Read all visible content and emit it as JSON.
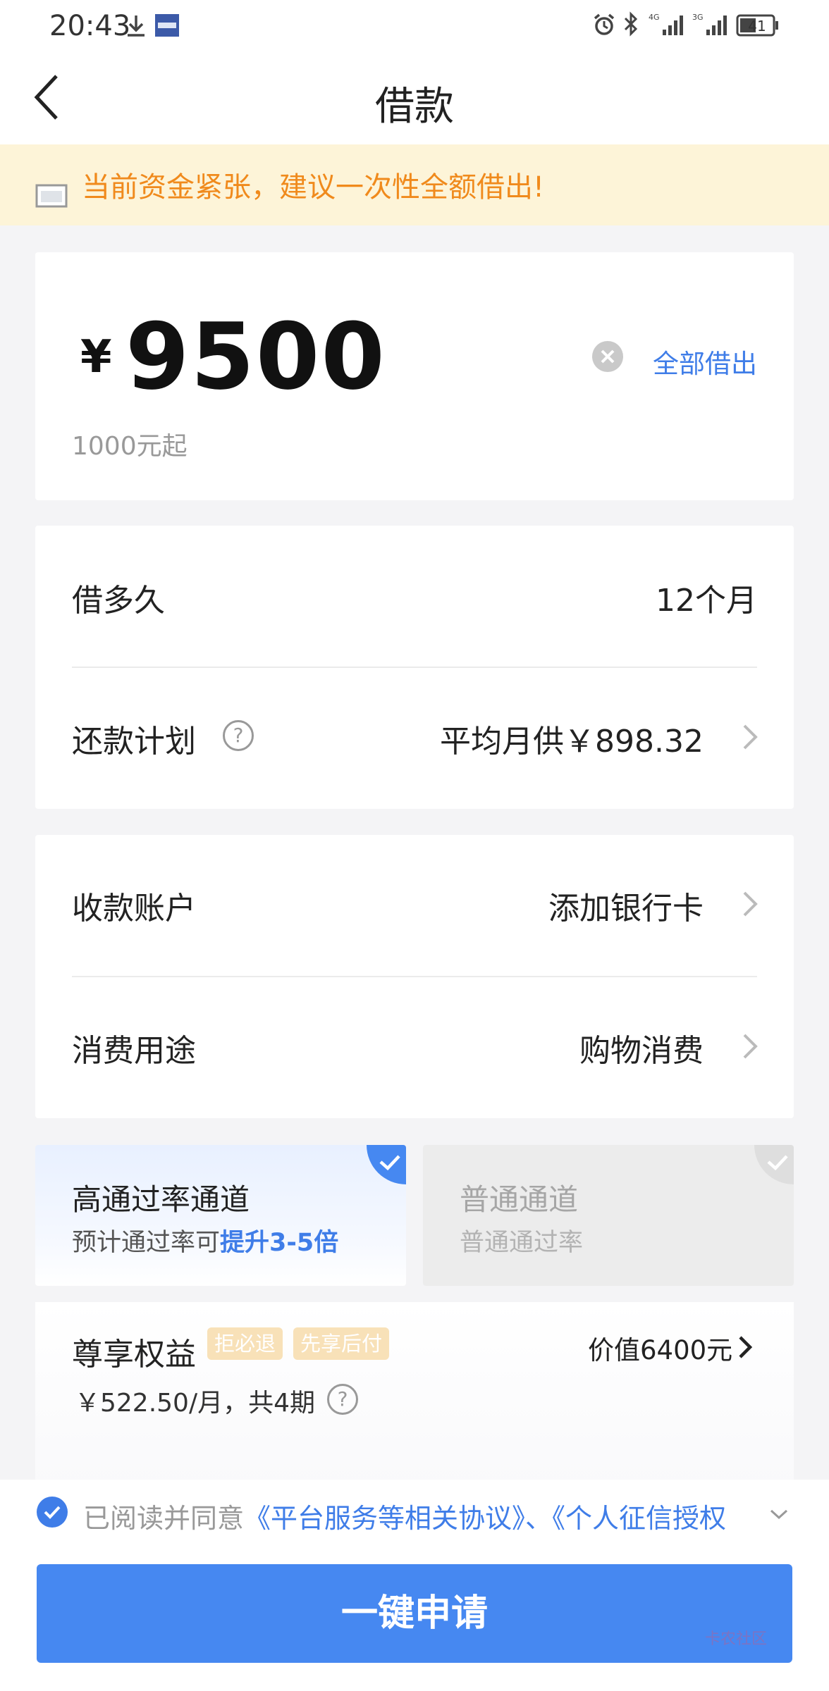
{
  "status_bar": {
    "time": "20:43",
    "icons": [
      "download-icon",
      "app-notification-icon",
      "alarm-icon",
      "bluetooth-icon",
      "signal-4g-icon",
      "signal-3g-icon",
      "battery-icon"
    ],
    "network_1": "4G",
    "network_2": "3G",
    "battery": "41"
  },
  "header": {
    "title": "借款",
    "back_icon": "chevron-left-icon"
  },
  "banner": {
    "text": "当前资金紧张，建议一次性全额借出!"
  },
  "amount": {
    "currency": "¥",
    "value": "9500",
    "hint": "1000元起",
    "borrow_all_label": "全部借出"
  },
  "term": {
    "label": "借多久",
    "value": "12个月"
  },
  "repayment": {
    "label": "还款计划",
    "value": "平均月供￥898.32"
  },
  "account": {
    "label": "收款账户",
    "value": "添加银行卡"
  },
  "purpose": {
    "label": "消费用途",
    "value": "购物消费"
  },
  "channels": {
    "high": {
      "title": "高通过率通道",
      "sub_prefix": "预计通过率可",
      "sub_highlight": "提升3-5倍",
      "selected": true
    },
    "normal": {
      "title": "普通通道",
      "sub": "普通通过率",
      "selected": false
    }
  },
  "benefits": {
    "title": "尊享权益",
    "tags": [
      "拒必退",
      "先享后付"
    ],
    "value": "价值6400元",
    "price": "￥522.50/月，共4期"
  },
  "agreement": {
    "prefix": "已阅读并同意",
    "link1": "《平台服务等相关协议》",
    "separator": "、",
    "link2": "《个人征信授权",
    "checked": true
  },
  "apply_button": "一键申请",
  "watermark": "卡农社区",
  "colors": {
    "accent": "#4688f1",
    "link": "#3f7de8",
    "banner_bg": "#fdf4d8",
    "banner_text": "#f08a1c",
    "tag_bg": "#f8e1b8"
  }
}
